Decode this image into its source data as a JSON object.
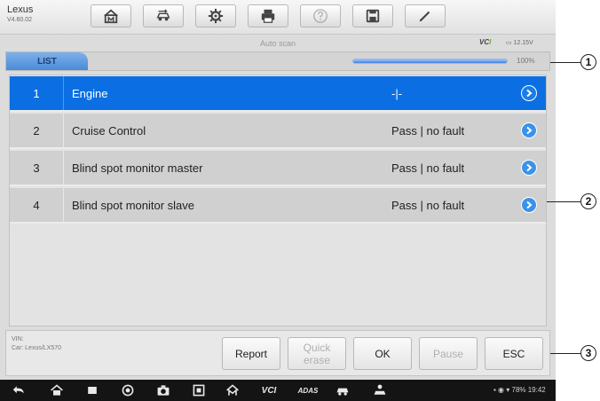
{
  "vehicle": {
    "make": "Lexus",
    "version": "V4.60.02"
  },
  "toolbar": {
    "buttons": [
      {
        "icon": "home-icon"
      },
      {
        "icon": "vehicle-swap-icon"
      },
      {
        "icon": "settings-icon"
      },
      {
        "icon": "print-icon"
      },
      {
        "icon": "help-icon",
        "disabled": true
      },
      {
        "icon": "save-icon"
      },
      {
        "icon": "pen-icon"
      }
    ]
  },
  "status": {
    "title": "Auto scan",
    "vci_label_a": "VC",
    "vci_label_b": "I",
    "battery": "12.15V"
  },
  "tab": {
    "label": "LIST",
    "progress": 1.0,
    "progress_text": "100%"
  },
  "list": {
    "rows": [
      {
        "num": "1",
        "name": "Engine",
        "status": "-|-",
        "selected": true
      },
      {
        "num": "2",
        "name": "Cruise Control",
        "status": "Pass | no fault",
        "selected": false
      },
      {
        "num": "3",
        "name": "Blind spot monitor master",
        "status": "Pass | no fault",
        "selected": false
      },
      {
        "num": "4",
        "name": "Blind spot monitor slave",
        "status": "Pass | no fault",
        "selected": false
      }
    ]
  },
  "info": {
    "vin": "VIN:",
    "car": "Car: Lexus/LX570"
  },
  "footer": {
    "report": "Report",
    "quick_erase": "Quick erase",
    "ok": "OK",
    "pause": "Pause",
    "esc": "ESC"
  },
  "navbar": {
    "vci_text": "VCI",
    "adas_text": "ADAS",
    "system_status": "78% 19:42"
  },
  "callouts": [
    "1",
    "2",
    "3"
  ],
  "colors": {
    "accent": "#0b6fe3",
    "row_bg": "#d0d0d0",
    "navbar_bg": "#141414"
  }
}
